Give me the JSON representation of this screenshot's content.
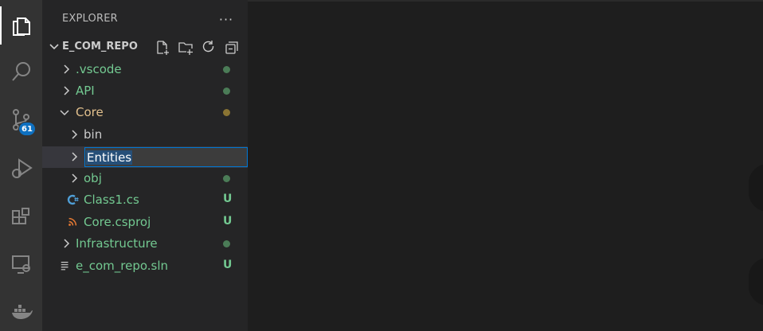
{
  "sidebar": {
    "title": "EXPLORER",
    "more_label": "···",
    "section": {
      "title": "E_COM_REPO"
    }
  },
  "activity": {
    "scm_badge": "61",
    "icons": [
      "explorer-icon",
      "search-icon",
      "source-control-icon",
      "run-debug-icon",
      "extensions-icon",
      "remote-explorer-icon",
      "docker-icon"
    ]
  },
  "tree": {
    "items": [
      {
        "label": ".vscode",
        "status": ""
      },
      {
        "label": "API",
        "status": ""
      },
      {
        "label": "Core",
        "status": ""
      },
      {
        "label": "bin",
        "status": ""
      },
      {
        "label": "Entities",
        "status": ""
      },
      {
        "label": "obj",
        "status": ""
      },
      {
        "label": "Class1.cs",
        "status": "U"
      },
      {
        "label": "Core.csproj",
        "status": "U"
      },
      {
        "label": "Infrastructure",
        "status": ""
      },
      {
        "label": "e_com_repo.sln",
        "status": "U"
      }
    ]
  },
  "colors": {
    "untracked": "#73c991",
    "modified": "#e2c08d",
    "accent": "#0078d4"
  }
}
